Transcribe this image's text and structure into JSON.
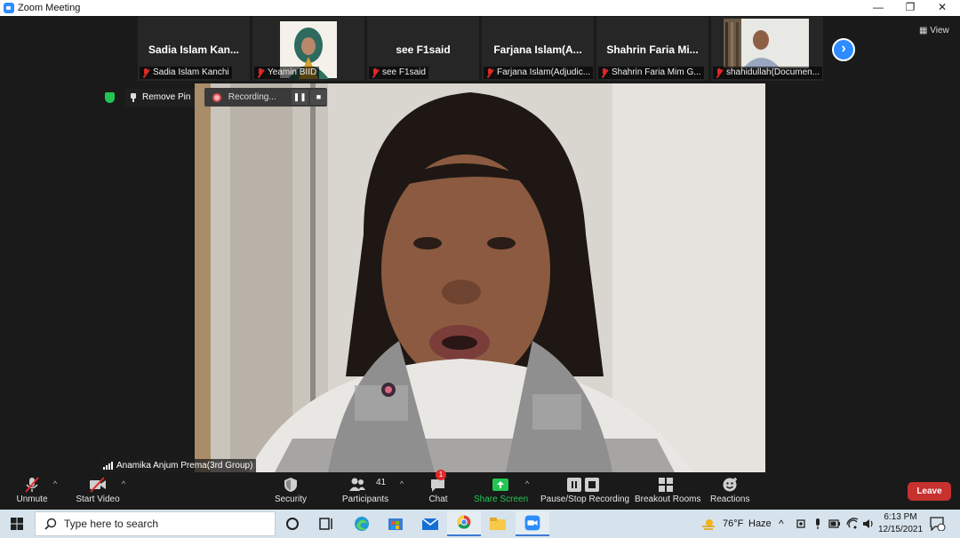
{
  "window": {
    "title": "Zoom Meeting"
  },
  "gallery": {
    "thumbnails": [
      {
        "display_name": "Sadia Islam Kan...",
        "label": "Sadia Islam Kanchi",
        "has_video": false
      },
      {
        "display_name": "",
        "label": "Yeamin BIID",
        "has_video": true
      },
      {
        "display_name": "see  F1said",
        "label": "see  F1said",
        "has_video": false
      },
      {
        "display_name": "Farjana Islam(A...",
        "label": "Farjana Islam(Adjudic...",
        "has_video": false
      },
      {
        "display_name": "Shahrin  Faria  Mi...",
        "label": "Shahrin Faria Mim  G...",
        "has_video": false
      },
      {
        "display_name": "",
        "label": "shahidullah(Documen...",
        "has_video": true
      }
    ],
    "view_label": "View"
  },
  "speaker": {
    "remove_pin_label": "Remove Pin",
    "recording_label": "Recording...",
    "name_label": "Anamika Anjum Prema(3rd Group)"
  },
  "toolbar": {
    "unmute": "Unmute",
    "start_video": "Start Video",
    "security": "Security",
    "participants": "Participants",
    "participants_count": "41",
    "chat": "Chat",
    "chat_badge": "1",
    "share_screen": "Share Screen",
    "pause_recording": "Pause/Stop Recording",
    "breakout_rooms": "Breakout Rooms",
    "reactions": "Reactions",
    "leave": "Leave"
  },
  "taskbar": {
    "search_placeholder": "Type here to search",
    "weather_temp": "76°F",
    "weather_desc": "Haze",
    "time": "6:13 PM",
    "date": "12/15/2021"
  },
  "colors": {
    "zoom_blue": "#2d8cff",
    "leave_red": "#c7312e",
    "share_green": "#23c552",
    "muted_red": "#e02828"
  }
}
